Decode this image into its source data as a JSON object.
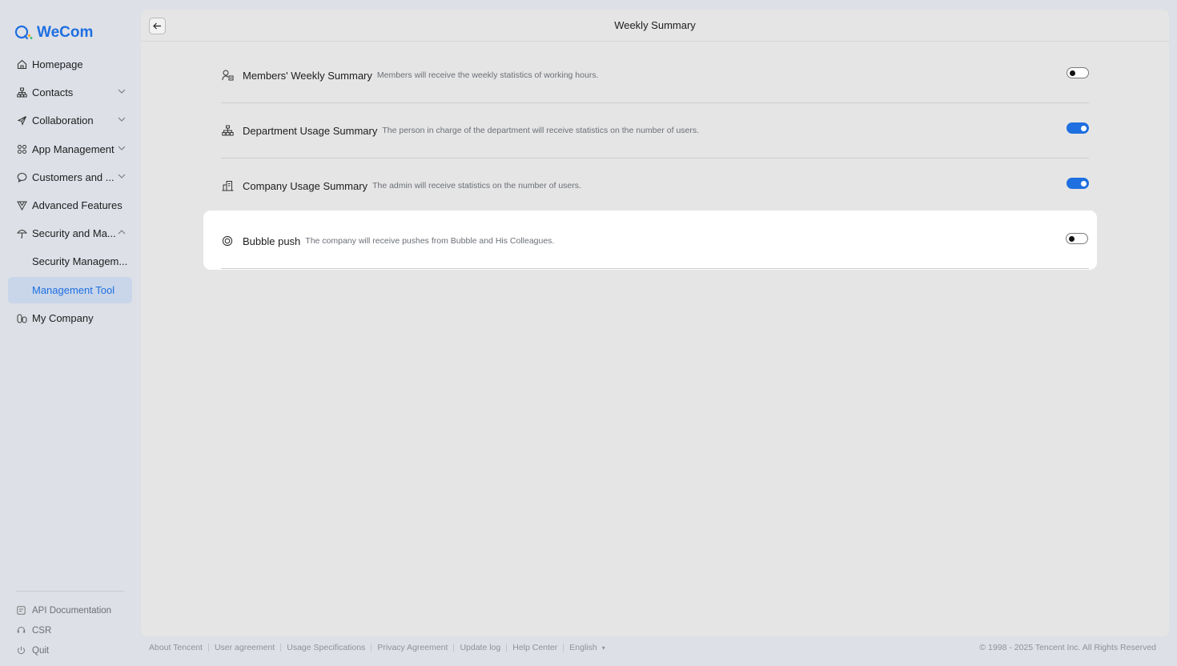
{
  "app": {
    "brand": "WeCom",
    "brand_color": "#1e6fe0"
  },
  "sidebar": {
    "items": [
      {
        "label": "Homepage",
        "icon": "home-icon"
      },
      {
        "label": "Contacts",
        "icon": "org-chart-icon",
        "expandable": true
      },
      {
        "label": "Collaboration",
        "icon": "collaboration-icon",
        "expandable": true
      },
      {
        "label": "App Management",
        "icon": "apps-grid-icon",
        "expandable": true
      },
      {
        "label": "Customers and ...",
        "icon": "chat-bubble-icon",
        "expandable": true
      },
      {
        "label": "Advanced Features",
        "icon": "diamond-icon"
      },
      {
        "label": "Security and Ma...",
        "icon": "umbrella-icon",
        "expandable": true,
        "expanded": true
      },
      {
        "label": "Security Managem...",
        "sub": true
      },
      {
        "label": "Management Tool",
        "sub": true,
        "active": true
      },
      {
        "label": "My Company",
        "icon": "company-icon"
      }
    ],
    "bottom": [
      {
        "label": "API Documentation",
        "icon": "api-doc-icon"
      },
      {
        "label": "CSR",
        "icon": "csr-icon"
      },
      {
        "label": "Quit",
        "icon": "power-icon"
      }
    ]
  },
  "main": {
    "title": "Weekly Summary",
    "rows": [
      {
        "title": "Members' Weekly Summary",
        "desc": "Members will receive the weekly statistics of working hours.",
        "icon": "member-icon",
        "enabled": false
      },
      {
        "title": "Department Usage Summary",
        "desc": "The person in charge of the department will receive statistics on the number of users.",
        "icon": "department-icon",
        "enabled": true
      },
      {
        "title": "Company Usage Summary",
        "desc": "The admin will receive statistics on the number of users.",
        "icon": "building-icon",
        "enabled": true
      },
      {
        "title": "Bubble push",
        "desc": "The company will receive pushes from Bubble and His Colleagues.",
        "icon": "bubble-icon",
        "enabled": false
      }
    ]
  },
  "footer": {
    "links": [
      "About Tencent",
      "User agreement",
      "Usage Specifications",
      "Privacy Agreement",
      "Update log",
      "Help Center"
    ],
    "language": "English",
    "copyright": "© 1998 - 2025 Tencent Inc. All Rights Reserved"
  }
}
